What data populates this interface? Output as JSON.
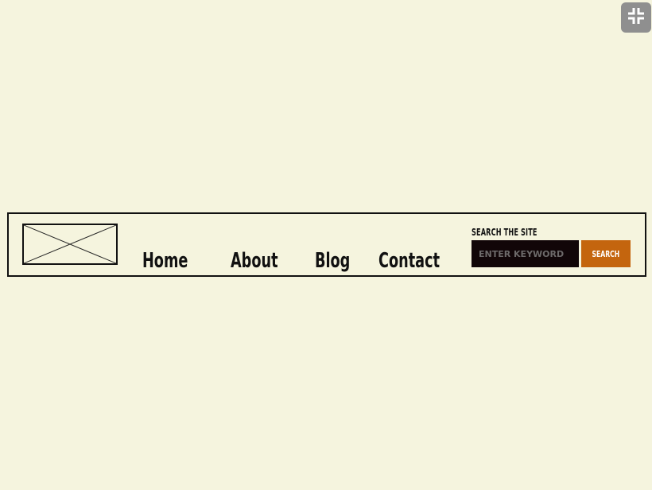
{
  "toolbar": {
    "collapse_icon": "collapse-icon"
  },
  "header": {
    "logo": "logo-placeholder-icon",
    "nav": {
      "items": [
        "Home",
        "About",
        "Blog",
        "Contact"
      ]
    },
    "search": {
      "label": "SEARCH THE SITE",
      "placeholder": "ENTER KEYWORD",
      "button_label": "SEARCH"
    }
  },
  "colors": {
    "page_background": "#f5f4de",
    "input_background": "#110608",
    "search_button": "#c4650e",
    "collapse_button": "#8f8f8f"
  }
}
